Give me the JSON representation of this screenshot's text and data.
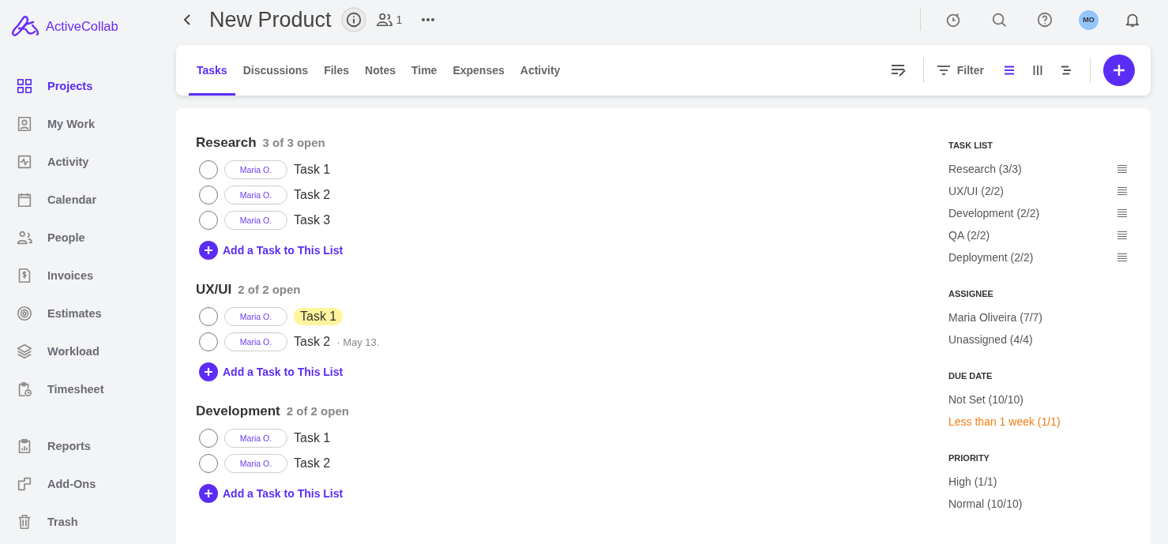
{
  "brand": {
    "name": "ActiveCollab"
  },
  "sidebar": {
    "groups": [
      {
        "items": [
          {
            "label": "Projects",
            "selected": true
          },
          {
            "label": "My Work",
            "selected": false
          },
          {
            "label": "Activity",
            "selected": false
          },
          {
            "label": "Calendar",
            "selected": false
          },
          {
            "label": "People",
            "selected": false
          },
          {
            "label": "Invoices",
            "selected": false
          },
          {
            "label": "Estimates",
            "selected": false
          },
          {
            "label": "Workload",
            "selected": false
          },
          {
            "label": "Timesheet",
            "selected": false
          }
        ]
      },
      {
        "items": [
          {
            "label": "Reports",
            "selected": false
          },
          {
            "label": "Add-Ons",
            "selected": false
          },
          {
            "label": "Trash",
            "selected": false
          }
        ]
      }
    ]
  },
  "header": {
    "title": "New Product",
    "members_count": "1",
    "avatar_initials": "MO"
  },
  "tabs": [
    {
      "label": "Tasks",
      "selected": true
    },
    {
      "label": "Discussions",
      "selected": false
    },
    {
      "label": "Files",
      "selected": false
    },
    {
      "label": "Notes",
      "selected": false
    },
    {
      "label": "Time",
      "selected": false
    },
    {
      "label": "Expenses",
      "selected": false
    },
    {
      "label": "Activity",
      "selected": false
    }
  ],
  "toolbar": {
    "filter_label": "Filter",
    "view_modes": [
      {
        "selected": true
      },
      {
        "selected": false
      },
      {
        "selected": false
      }
    ]
  },
  "task_lists": [
    {
      "name": "Research",
      "count": "3 of 3 open",
      "add_label": "Add a Task to This List",
      "tasks": [
        {
          "assignee": "Maria O.",
          "name": "Task 1",
          "highlighted": false,
          "completed": false
        },
        {
          "assignee": "Maria O.",
          "name": "Task 2",
          "highlighted": false,
          "completed": false
        },
        {
          "assignee": "Maria O.",
          "name": "Task 3",
          "highlighted": false,
          "completed": false
        }
      ]
    },
    {
      "name": "UX/UI",
      "count": "2 of 2 open",
      "add_label": "Add a Task to This List",
      "tasks": [
        {
          "assignee": "Maria O.",
          "name": "Task 1",
          "highlighted": true,
          "completed": false
        },
        {
          "assignee": "Maria O.",
          "name": "Task 2",
          "highlighted": false,
          "completed": false,
          "due": "· May 13."
        }
      ]
    },
    {
      "name": "Development",
      "count": "2 of 2 open",
      "add_label": "Add a Task to This List",
      "tasks": [
        {
          "assignee": "Maria O.",
          "name": "Task 1",
          "highlighted": false,
          "completed": false
        },
        {
          "assignee": "Maria O.",
          "name": "Task 2",
          "highlighted": false,
          "completed": false
        }
      ]
    }
  ],
  "filters": [
    {
      "heading": "TASK LIST",
      "reorderable": true,
      "items": [
        {
          "label": "Research (3/3)",
          "warning": false
        },
        {
          "label": "UX/UI (2/2)",
          "warning": false
        },
        {
          "label": "Development (2/2)",
          "warning": false
        },
        {
          "label": "QA (2/2)",
          "warning": false
        },
        {
          "label": "Deployment (2/2)",
          "warning": false
        }
      ]
    },
    {
      "heading": "ASSIGNEE",
      "reorderable": false,
      "items": [
        {
          "label": "Maria Oliveira (7/7)",
          "warning": false
        },
        {
          "label": "Unassigned (4/4)",
          "warning": false
        }
      ]
    },
    {
      "heading": "DUE DATE",
      "reorderable": false,
      "items": [
        {
          "label": "Not Set (10/10)",
          "warning": false
        },
        {
          "label": "Less than 1 week (1/1)",
          "warning": true
        }
      ]
    },
    {
      "heading": "PRIORITY",
      "reorderable": false,
      "items": [
        {
          "label": "High (1/1)",
          "warning": false
        },
        {
          "label": "Normal (10/10)",
          "warning": false
        }
      ]
    }
  ]
}
